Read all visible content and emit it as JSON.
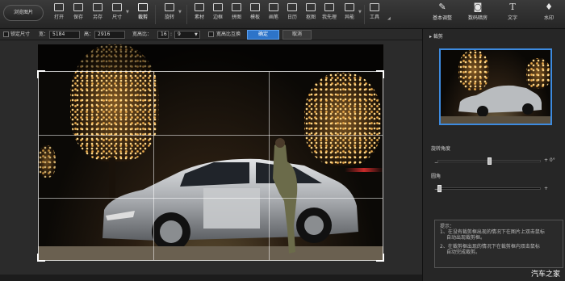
{
  "toolbar": {
    "browse_label": "浏览图片",
    "tools": [
      {
        "label": "打开",
        "icon": "open-icon"
      },
      {
        "label": "保存",
        "icon": "save-icon"
      },
      {
        "label": "另存",
        "icon": "save-as-icon"
      },
      {
        "label": "尺寸",
        "icon": "resize-icon"
      },
      {
        "label": "裁剪",
        "icon": "crop-icon",
        "active": true
      },
      {
        "label": "旋转",
        "icon": "rotate-icon"
      },
      {
        "label": "素材",
        "icon": "material-icon"
      },
      {
        "label": "边框",
        "icon": "border-icon"
      },
      {
        "label": "拼图",
        "icon": "collage-icon"
      },
      {
        "label": "模板",
        "icon": "template-icon"
      },
      {
        "label": "画笔",
        "icon": "brush-icon"
      },
      {
        "label": "日历",
        "icon": "calendar-icon"
      },
      {
        "label": "抠图",
        "icon": "cutout-icon"
      },
      {
        "label": "我先理",
        "icon": "manage-icon"
      },
      {
        "label": "异能",
        "icon": "special-icon"
      },
      {
        "label": "工具",
        "icon": "tools-icon"
      }
    ],
    "right_tools": [
      {
        "label": "基本调整",
        "icon": "adjust-icon"
      },
      {
        "label": "数码暗房",
        "icon": "camera-icon"
      },
      {
        "label": "文字",
        "icon": "text-icon"
      },
      {
        "label": "水印",
        "icon": "watermark-icon"
      }
    ]
  },
  "options": {
    "lock_size_label": "锁定尺寸",
    "width_label": "宽：",
    "width_value": "5184",
    "height_label": "高：",
    "height_value": "2916",
    "ratio_label": "宽高比：",
    "ratio_a": "16",
    "ratio_sep": ":",
    "ratio_b": "9",
    "swap_label": "宽高比互换",
    "ok_label": "确定",
    "cancel_label": "取消"
  },
  "panel": {
    "title": "裁剪",
    "rotate_label": "旋转角度",
    "rotate_value": "+ 0°",
    "corner_label": "圆角",
    "rotate_level": 0.5,
    "corner_level": 0.0,
    "tip_title": "提示：",
    "tip_1a": "1、在没有裁剪框出现的情况下在图片上双击鼠标",
    "tip_1b": "自动出现裁剪框。",
    "tip_2a": "2、在裁剪框出现的情况下在裁剪框内双击鼠标",
    "tip_2b": "自动完成裁剪。"
  },
  "watermark": "汽车之家",
  "colors": {
    "accent": "#2d74c9",
    "thumb_border": "#3d8be0"
  }
}
